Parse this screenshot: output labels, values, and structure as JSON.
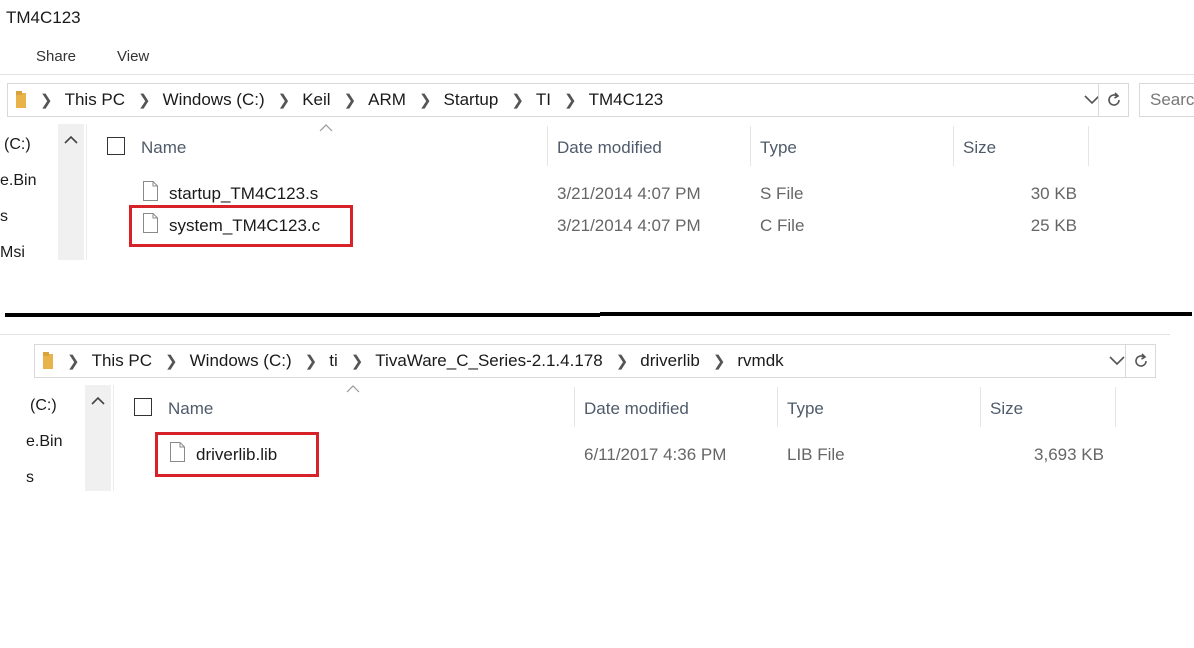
{
  "window": {
    "title": "TM4C123"
  },
  "ribbon": {
    "tabs": [
      "Share",
      "View"
    ]
  },
  "top": {
    "breadcrumb": [
      "This PC",
      "Windows (C:)",
      "Keil",
      "ARM",
      "Startup",
      "TI",
      "TM4C123"
    ],
    "search_placeholder": "Search",
    "nav_items": [
      "(C:)",
      "e.Bin",
      "s",
      "Msi"
    ],
    "columns": [
      "Name",
      "Date modified",
      "Type",
      "Size"
    ],
    "files": [
      {
        "name": "startup_TM4C123.s",
        "date": "3/21/2014 4:07 PM",
        "type": "S File",
        "size": "30 KB",
        "highlighted": false
      },
      {
        "name": "system_TM4C123.c",
        "date": "3/21/2014 4:07 PM",
        "type": "C File",
        "size": "25 KB",
        "highlighted": true
      }
    ]
  },
  "bottom": {
    "breadcrumb": [
      "This PC",
      "Windows (C:)",
      "ti",
      "TivaWare_C_Series-2.1.4.178",
      "driverlib",
      "rvmdk"
    ],
    "nav_items": [
      "(C:)",
      "e.Bin",
      "s"
    ],
    "columns": [
      "Name",
      "Date modified",
      "Type",
      "Size"
    ],
    "files": [
      {
        "name": "driverlib.lib",
        "date": "6/11/2017 4:36 PM",
        "type": "LIB File",
        "size": "3,693 KB",
        "highlighted": true
      }
    ]
  },
  "icons": {
    "folder": "folder-icon",
    "file": "file-icon",
    "refresh": "refresh-icon",
    "dropdown": "chevron-down-icon"
  },
  "colors": {
    "highlight": "#d7222a",
    "folder": "#e8b34a"
  }
}
